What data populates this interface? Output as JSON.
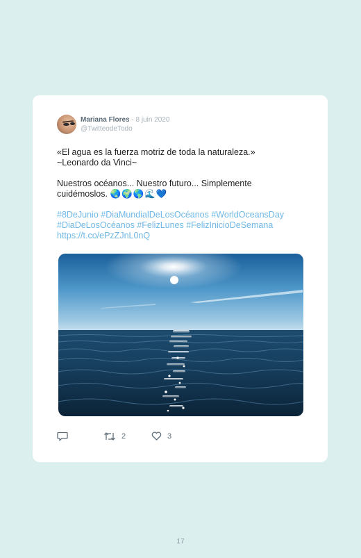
{
  "tweet": {
    "author_name": "Mariana Flores",
    "separator": " - ",
    "date": "8 juin 2020",
    "handle": "@TwitteodeTodo",
    "lines": {
      "quote_line1": "«El agua es la fuerza motriz de toda la naturaleza.»",
      "quote_line2": "~Leonardo da Vinci~",
      "body_line1": "Nuestros océanos... Nuestro futuro... Simplemente",
      "body_line2": "cuidémoslos. ",
      "emojis": "🌏🌍🌎🌊💙",
      "hashtags_line1": "#8DeJunio #DiaMundialDeLosOcéanos #WorldOceansDay",
      "hashtags_line2": "#DiaDeLosOcéanos #FelizLunes #FelizInicioDeSemana",
      "link": "https://t.co/ePzZJnL0nQ"
    },
    "image_icon": "ocean-horizon-photo",
    "actions": {
      "reply_icon": "comment-icon",
      "retweet_icon": "retweet-icon",
      "retweet_count": "2",
      "like_icon": "heart-icon",
      "like_count": "3"
    }
  },
  "page_number": "17",
  "colors": {
    "background": "#dcefef",
    "card": "#ffffff",
    "link": "#6fb8e6",
    "name": "#5a6b78",
    "muted": "#a7b2b9"
  }
}
